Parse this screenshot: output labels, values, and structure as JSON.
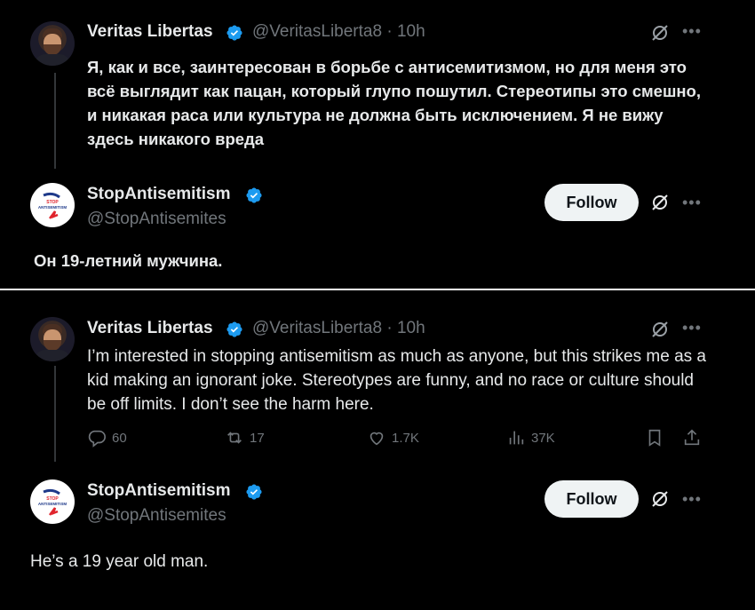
{
  "top": {
    "tweet": {
      "author_name": "Veritas Libertas",
      "handle": "@VeritasLiberta8",
      "separator": "·",
      "time": "10h",
      "text": "Я, как и все, заинтересован в борьбе с антисемитизмом, но для меня это всё выглядит как пацан, который глупо пошутил. Стереотипы это смешно, и никакая раса или культура не должна быть исключением. Я не вижу здесь никакого вреда"
    },
    "reply": {
      "author_name": "StopAntisemitism",
      "handle": "@StopAntisemites",
      "follow_label": "Follow",
      "text": "Он 19-летний мужчина."
    }
  },
  "bottom": {
    "tweet": {
      "author_name": "Veritas Libertas",
      "handle": "@VeritasLiberta8",
      "separator": "·",
      "time": "10h",
      "text": "I’m interested in stopping antisemitism as much as anyone, but this strikes me as a kid making an ignorant joke. Stereotypes are funny, and no race or culture should be off limits. I don’t see the harm here.",
      "actions": {
        "replies": "60",
        "reposts": "17",
        "likes": "1.7K",
        "views": "37K"
      }
    },
    "reply": {
      "author_name": "StopAntisemitism",
      "handle": "@StopAntisemites",
      "follow_label": "Follow",
      "text": "He’s a 19 year old man."
    }
  },
  "avatar_logo_text": [
    "STOP",
    "ANTISEMITISM"
  ],
  "colors": {
    "background": "#000000",
    "text_primary": "#e7e9ea",
    "text_secondary": "#71767b",
    "verified_blue": "#1d9bf0",
    "follow_bg": "#eff3f4",
    "logo_red": "#e0242d",
    "logo_blue": "#1f3a8a"
  },
  "icons": [
    "verified-badge-icon",
    "grok-slash-icon",
    "more-icon",
    "reply-icon",
    "repost-icon",
    "like-icon",
    "views-icon",
    "bookmark-icon",
    "share-icon"
  ]
}
